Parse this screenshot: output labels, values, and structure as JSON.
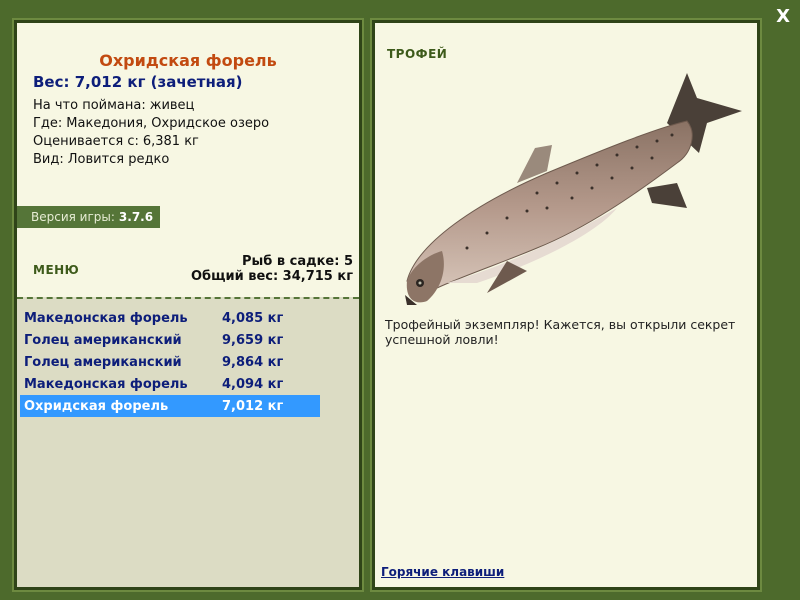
{
  "close_label": "X",
  "fish": {
    "title": "Охридская форель",
    "weight": "Вес: 7,012 кг (зачетная)",
    "info": [
      {
        "label": "На что поймана:",
        "value": "живец"
      },
      {
        "label": "Где:",
        "value": "Македония, Охридское озеро"
      },
      {
        "label": "Оценивается с:",
        "value": "6,381 кг"
      },
      {
        "label": "Вид:",
        "value": "Ловится редко"
      }
    ]
  },
  "version": {
    "label": "Версия игры:",
    "value": "3.7.6"
  },
  "menu_label": "МЕНЮ",
  "cage": {
    "count": "Рыб в садке: 5",
    "total": "Общий вес: 34,715 кг"
  },
  "catches": [
    {
      "name": "Македонская форель",
      "weight": "4,085 кг"
    },
    {
      "name": "Голец американский",
      "weight": "9,659 кг"
    },
    {
      "name": "Голец американский",
      "weight": "9,864 кг"
    },
    {
      "name": "Македонская форель",
      "weight": "4,094 кг"
    },
    {
      "name": "Охридская форель",
      "weight": "7,012 кг"
    }
  ],
  "trophy": {
    "label": "ТРОФЕЙ",
    "text": "Трофейный экземпляр! Кажется, вы открыли секрет успешной ловли!"
  },
  "hotkeys_label": "Горячие клавиши",
  "colors": {
    "frame": "#4d6a2c",
    "panel": "#f7f7e3",
    "selected": "#3399ff"
  }
}
